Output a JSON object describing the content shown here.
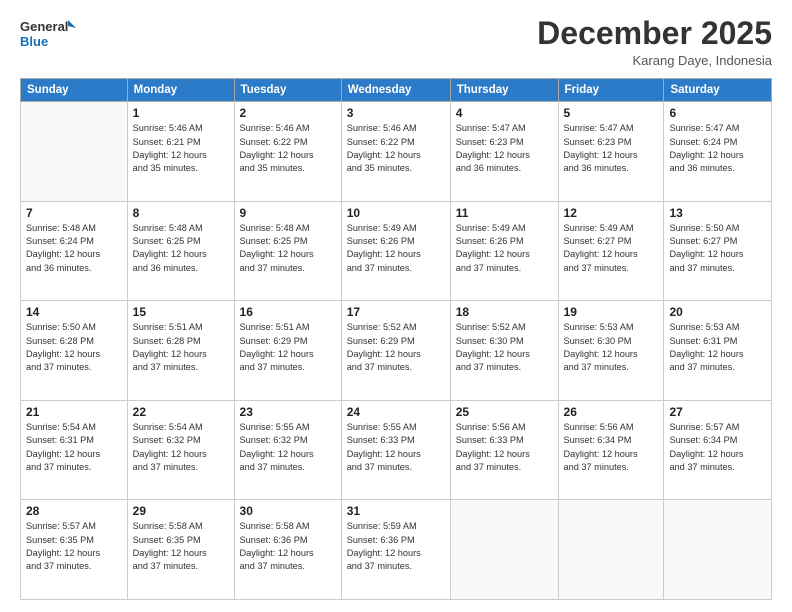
{
  "logo": {
    "line1": "General",
    "line2": "Blue"
  },
  "title": "December 2025",
  "subtitle": "Karang Daye, Indonesia",
  "weekdays": [
    "Sunday",
    "Monday",
    "Tuesday",
    "Wednesday",
    "Thursday",
    "Friday",
    "Saturday"
  ],
  "weeks": [
    [
      {
        "day": "",
        "info": ""
      },
      {
        "day": "1",
        "info": "Sunrise: 5:46 AM\nSunset: 6:21 PM\nDaylight: 12 hours\nand 35 minutes."
      },
      {
        "day": "2",
        "info": "Sunrise: 5:46 AM\nSunset: 6:22 PM\nDaylight: 12 hours\nand 35 minutes."
      },
      {
        "day": "3",
        "info": "Sunrise: 5:46 AM\nSunset: 6:22 PM\nDaylight: 12 hours\nand 35 minutes."
      },
      {
        "day": "4",
        "info": "Sunrise: 5:47 AM\nSunset: 6:23 PM\nDaylight: 12 hours\nand 36 minutes."
      },
      {
        "day": "5",
        "info": "Sunrise: 5:47 AM\nSunset: 6:23 PM\nDaylight: 12 hours\nand 36 minutes."
      },
      {
        "day": "6",
        "info": "Sunrise: 5:47 AM\nSunset: 6:24 PM\nDaylight: 12 hours\nand 36 minutes."
      }
    ],
    [
      {
        "day": "7",
        "info": "Sunrise: 5:48 AM\nSunset: 6:24 PM\nDaylight: 12 hours\nand 36 minutes."
      },
      {
        "day": "8",
        "info": "Sunrise: 5:48 AM\nSunset: 6:25 PM\nDaylight: 12 hours\nand 36 minutes."
      },
      {
        "day": "9",
        "info": "Sunrise: 5:48 AM\nSunset: 6:25 PM\nDaylight: 12 hours\nand 37 minutes."
      },
      {
        "day": "10",
        "info": "Sunrise: 5:49 AM\nSunset: 6:26 PM\nDaylight: 12 hours\nand 37 minutes."
      },
      {
        "day": "11",
        "info": "Sunrise: 5:49 AM\nSunset: 6:26 PM\nDaylight: 12 hours\nand 37 minutes."
      },
      {
        "day": "12",
        "info": "Sunrise: 5:49 AM\nSunset: 6:27 PM\nDaylight: 12 hours\nand 37 minutes."
      },
      {
        "day": "13",
        "info": "Sunrise: 5:50 AM\nSunset: 6:27 PM\nDaylight: 12 hours\nand 37 minutes."
      }
    ],
    [
      {
        "day": "14",
        "info": "Sunrise: 5:50 AM\nSunset: 6:28 PM\nDaylight: 12 hours\nand 37 minutes."
      },
      {
        "day": "15",
        "info": "Sunrise: 5:51 AM\nSunset: 6:28 PM\nDaylight: 12 hours\nand 37 minutes."
      },
      {
        "day": "16",
        "info": "Sunrise: 5:51 AM\nSunset: 6:29 PM\nDaylight: 12 hours\nand 37 minutes."
      },
      {
        "day": "17",
        "info": "Sunrise: 5:52 AM\nSunset: 6:29 PM\nDaylight: 12 hours\nand 37 minutes."
      },
      {
        "day": "18",
        "info": "Sunrise: 5:52 AM\nSunset: 6:30 PM\nDaylight: 12 hours\nand 37 minutes."
      },
      {
        "day": "19",
        "info": "Sunrise: 5:53 AM\nSunset: 6:30 PM\nDaylight: 12 hours\nand 37 minutes."
      },
      {
        "day": "20",
        "info": "Sunrise: 5:53 AM\nSunset: 6:31 PM\nDaylight: 12 hours\nand 37 minutes."
      }
    ],
    [
      {
        "day": "21",
        "info": "Sunrise: 5:54 AM\nSunset: 6:31 PM\nDaylight: 12 hours\nand 37 minutes."
      },
      {
        "day": "22",
        "info": "Sunrise: 5:54 AM\nSunset: 6:32 PM\nDaylight: 12 hours\nand 37 minutes."
      },
      {
        "day": "23",
        "info": "Sunrise: 5:55 AM\nSunset: 6:32 PM\nDaylight: 12 hours\nand 37 minutes."
      },
      {
        "day": "24",
        "info": "Sunrise: 5:55 AM\nSunset: 6:33 PM\nDaylight: 12 hours\nand 37 minutes."
      },
      {
        "day": "25",
        "info": "Sunrise: 5:56 AM\nSunset: 6:33 PM\nDaylight: 12 hours\nand 37 minutes."
      },
      {
        "day": "26",
        "info": "Sunrise: 5:56 AM\nSunset: 6:34 PM\nDaylight: 12 hours\nand 37 minutes."
      },
      {
        "day": "27",
        "info": "Sunrise: 5:57 AM\nSunset: 6:34 PM\nDaylight: 12 hours\nand 37 minutes."
      }
    ],
    [
      {
        "day": "28",
        "info": "Sunrise: 5:57 AM\nSunset: 6:35 PM\nDaylight: 12 hours\nand 37 minutes."
      },
      {
        "day": "29",
        "info": "Sunrise: 5:58 AM\nSunset: 6:35 PM\nDaylight: 12 hours\nand 37 minutes."
      },
      {
        "day": "30",
        "info": "Sunrise: 5:58 AM\nSunset: 6:36 PM\nDaylight: 12 hours\nand 37 minutes."
      },
      {
        "day": "31",
        "info": "Sunrise: 5:59 AM\nSunset: 6:36 PM\nDaylight: 12 hours\nand 37 minutes."
      },
      {
        "day": "",
        "info": ""
      },
      {
        "day": "",
        "info": ""
      },
      {
        "day": "",
        "info": ""
      }
    ]
  ]
}
